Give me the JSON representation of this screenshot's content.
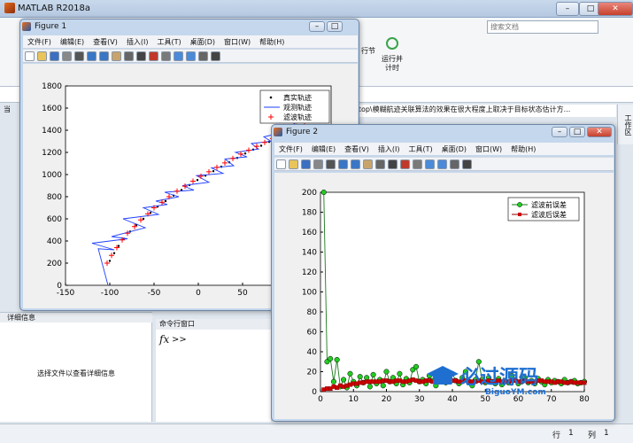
{
  "main": {
    "title": "MATLAB R2018a",
    "search_placeholder": "搜索文档",
    "ribbon_run": "运行并\n计时",
    "ribbon_section": "行节",
    "path": "sktop\\模糊航迹关联算法的效果在很大程度上取决于目标状态估计方...",
    "left_label": "当",
    "side_tab": "工作区",
    "detail_title": "详细信息",
    "detail_msg": "选择文件以查看详细信息",
    "cmd_title": "命令行窗口",
    "cmd_prompt": "fx",
    "cmd_arrow": ">>",
    "status_row_label": "行",
    "status_row": "1",
    "status_col_label": "列",
    "status_col": "1"
  },
  "menus": [
    "文件(F)",
    "编辑(E)",
    "查看(V)",
    "插入(I)",
    "工具(T)",
    "桌面(D)",
    "窗口(W)",
    "帮助(H)"
  ],
  "icons": [
    "new-icon",
    "open-icon",
    "save-icon",
    "print-icon",
    "pointer-icon",
    "zoom-in-icon",
    "zoom-out-icon",
    "pan-icon",
    "rotate-icon",
    "data-cursor-icon",
    "brush-icon",
    "link-icon",
    "legend-icon",
    "colorbar-icon",
    "grid-icon",
    "property-icon"
  ],
  "figure1": {
    "title": "Figure 1",
    "legend": [
      "真实轨迹",
      "观测轨迹",
      "滤波轨迹"
    ]
  },
  "figure2": {
    "title": "Figure 2",
    "legend": [
      "滤波前误差",
      "滤波后误差"
    ]
  },
  "watermark": {
    "text": "必过源码",
    "sub": "BiguoYM.com"
  },
  "chart_data": [
    {
      "type": "line",
      "xlim": [
        -150,
        150
      ],
      "ylim": [
        0,
        1800
      ],
      "xticks": [
        -150,
        -100,
        -50,
        0,
        50,
        100
      ],
      "yticks": [
        0,
        200,
        400,
        600,
        800,
        1000,
        1200,
        1400,
        1600,
        1800
      ],
      "legend_position": "top-right",
      "series": [
        {
          "name": "真实轨迹",
          "color": "#000000",
          "marker": "dot",
          "x": [
            -100,
            -95,
            -90,
            -84,
            -77,
            -70,
            -62,
            -54,
            -46,
            -37,
            -28,
            -19,
            -10,
            -1,
            8,
            17,
            26,
            35,
            44,
            53,
            62,
            71,
            80,
            89,
            98,
            107,
            116,
            125
          ],
          "y": [
            220,
            290,
            355,
            420,
            485,
            545,
            600,
            655,
            710,
            760,
            810,
            860,
            905,
            950,
            990,
            1030,
            1070,
            1110,
            1150,
            1190,
            1225,
            1260,
            1295,
            1330,
            1365,
            1400,
            1440,
            1480
          ]
        },
        {
          "name": "观测轨迹",
          "color": "#1f3fff",
          "marker": "none",
          "x": [
            -102,
            -113,
            -95,
            -120,
            -80,
            -98,
            -60,
            -85,
            -45,
            -62,
            -35,
            -48,
            -22,
            -38,
            -5,
            -18,
            12,
            -2,
            28,
            15,
            40,
            30,
            55,
            42,
            68,
            60,
            82,
            74,
            95,
            90,
            110,
            105,
            125
          ],
          "y": [
            0,
            330,
            320,
            380,
            420,
            440,
            520,
            600,
            640,
            700,
            730,
            760,
            800,
            840,
            860,
            900,
            930,
            990,
            1010,
            1060,
            1080,
            1140,
            1160,
            1200,
            1230,
            1280,
            1300,
            1340,
            1380,
            1420,
            1450,
            1480,
            1510
          ]
        },
        {
          "name": "滤波轨迹",
          "color": "#ff0000",
          "marker": "plus",
          "x": [
            -103,
            -98,
            -92,
            -86,
            -80,
            -72,
            -65,
            -57,
            -50,
            -41,
            -33,
            -24,
            -15,
            -6,
            3,
            12,
            21,
            30,
            39,
            48,
            57,
            66,
            75,
            84,
            93,
            102,
            111,
            120
          ],
          "y": [
            200,
            270,
            340,
            410,
            470,
            530,
            590,
            645,
            700,
            750,
            800,
            850,
            895,
            940,
            985,
            1025,
            1065,
            1105,
            1145,
            1185,
            1220,
            1255,
            1290,
            1325,
            1360,
            1400,
            1435,
            1480
          ]
        }
      ]
    },
    {
      "type": "line",
      "xlim": [
        0,
        80
      ],
      "ylim": [
        0,
        200
      ],
      "xticks": [
        0,
        10,
        20,
        30,
        40,
        50,
        60,
        70,
        80
      ],
      "yticks": [
        0,
        20,
        40,
        60,
        80,
        100,
        120,
        140,
        160,
        180,
        200
      ],
      "legend_position": "top-right",
      "series": [
        {
          "name": "滤波前误差",
          "color": "#1a7a1a",
          "marker_color": "#22cc22",
          "marker": "circle",
          "x": [
            1,
            2,
            3,
            4,
            5,
            6,
            7,
            8,
            9,
            10,
            11,
            12,
            13,
            14,
            15,
            16,
            17,
            18,
            19,
            20,
            21,
            22,
            23,
            24,
            25,
            26,
            27,
            28,
            29,
            30,
            31,
            32,
            33,
            34,
            35,
            36,
            37,
            38,
            39,
            40,
            41,
            42,
            43,
            44,
            45,
            46,
            47,
            48,
            49,
            50,
            51,
            52,
            53,
            54,
            55,
            56,
            57,
            58,
            59,
            60,
            61,
            62,
            63,
            64,
            65,
            66,
            67,
            68,
            69,
            70,
            71,
            72,
            73,
            74,
            75,
            76,
            77,
            78,
            79,
            80
          ],
          "y": [
            200,
            30,
            33,
            10,
            32,
            5,
            12,
            4,
            18,
            10,
            6,
            15,
            9,
            14,
            5,
            17,
            8,
            12,
            6,
            20,
            10,
            14,
            8,
            18,
            7,
            13,
            9,
            22,
            25,
            10,
            12,
            8,
            16,
            11,
            6,
            14,
            10,
            9,
            12,
            18,
            11,
            8,
            14,
            20,
            10,
            6,
            12,
            30,
            12,
            9,
            14,
            10,
            8,
            13,
            7,
            11,
            9,
            16,
            12,
            8,
            10,
            14,
            9,
            11,
            8,
            13,
            10,
            7,
            12,
            9,
            11,
            10,
            8,
            12,
            9,
            10,
            11,
            8,
            9,
            10
          ]
        },
        {
          "name": "滤波后误差",
          "color": "#8b0000",
          "marker_color": "#cc0000",
          "marker": "square",
          "x": [
            1,
            2,
            3,
            4,
            5,
            6,
            7,
            8,
            9,
            10,
            11,
            12,
            13,
            14,
            15,
            16,
            17,
            18,
            19,
            20,
            21,
            22,
            23,
            24,
            25,
            26,
            27,
            28,
            29,
            30,
            31,
            32,
            33,
            34,
            35,
            36,
            37,
            38,
            39,
            40,
            41,
            42,
            43,
            44,
            45,
            46,
            47,
            48,
            49,
            50,
            51,
            52,
            53,
            54,
            55,
            56,
            57,
            58,
            59,
            60,
            61,
            62,
            63,
            64,
            65,
            66,
            67,
            68,
            69,
            70,
            71,
            72,
            73,
            74,
            75,
            76,
            77,
            78,
            79,
            80
          ],
          "y": [
            2,
            3,
            3,
            5,
            4,
            6,
            5,
            6,
            7,
            8,
            8,
            9,
            9,
            10,
            10,
            10,
            10,
            10,
            11,
            11,
            10,
            10,
            11,
            11,
            10,
            10,
            11,
            12,
            11,
            10,
            10,
            11,
            11,
            10,
            10,
            10,
            11,
            11,
            10,
            11,
            11,
            10,
            10,
            11,
            10,
            10,
            10,
            11,
            10,
            10,
            11,
            10,
            10,
            11,
            10,
            10,
            10,
            11,
            11,
            10,
            10,
            11,
            10,
            10,
            10,
            11,
            11,
            10,
            10,
            10,
            9,
            10,
            10,
            9,
            9,
            10,
            9,
            9,
            9,
            9
          ]
        }
      ]
    }
  ]
}
